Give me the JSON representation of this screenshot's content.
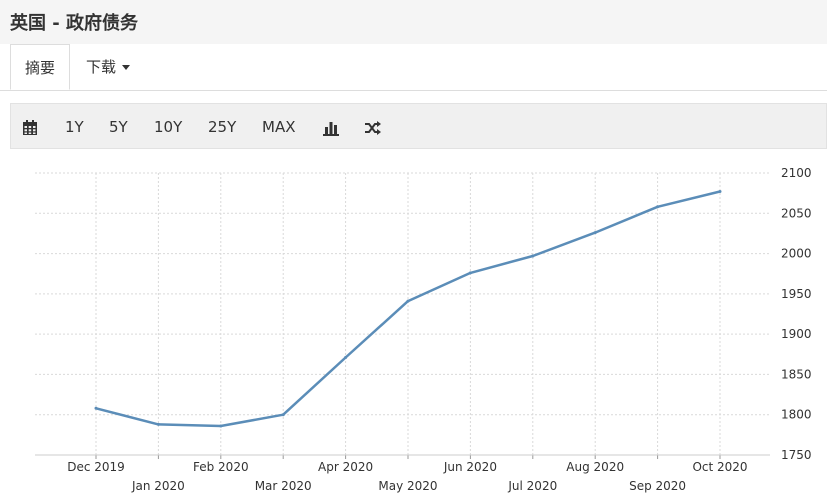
{
  "header": {
    "title": "英国 - 政府债务"
  },
  "tabs": {
    "summary": "摘要",
    "download": "下载"
  },
  "toolbar": {
    "calendar_icon": "calendar-icon",
    "ranges": [
      "1Y",
      "5Y",
      "10Y",
      "25Y",
      "MAX"
    ],
    "bar_icon": "bar-chart-icon",
    "shuffle_icon": "shuffle-icon"
  },
  "colors": {
    "line": "#5b8db8",
    "grid": "#d9d9d9",
    "toolbar_bg": "#f0f0f0"
  },
  "chart_data": {
    "type": "line",
    "title": "",
    "xlabel": "",
    "ylabel": "",
    "ylim": [
      1750,
      2100
    ],
    "y_ticks": [
      1750,
      1800,
      1850,
      1900,
      1950,
      2000,
      2050,
      2100
    ],
    "grid": true,
    "x_tick_labels": [
      "Dec 2019",
      "Jan 2020",
      "Feb 2020",
      "Mar 2020",
      "Apr 2020",
      "May 2020",
      "Jun 2020",
      "Jul 2020",
      "Aug 2020",
      "Sep 2020",
      "Oct 2020"
    ],
    "series": [
      {
        "values": [
          1808,
          1788,
          1786,
          1800,
          1871,
          1941,
          1976,
          1997,
          2026,
          2058,
          2077
        ]
      }
    ]
  }
}
